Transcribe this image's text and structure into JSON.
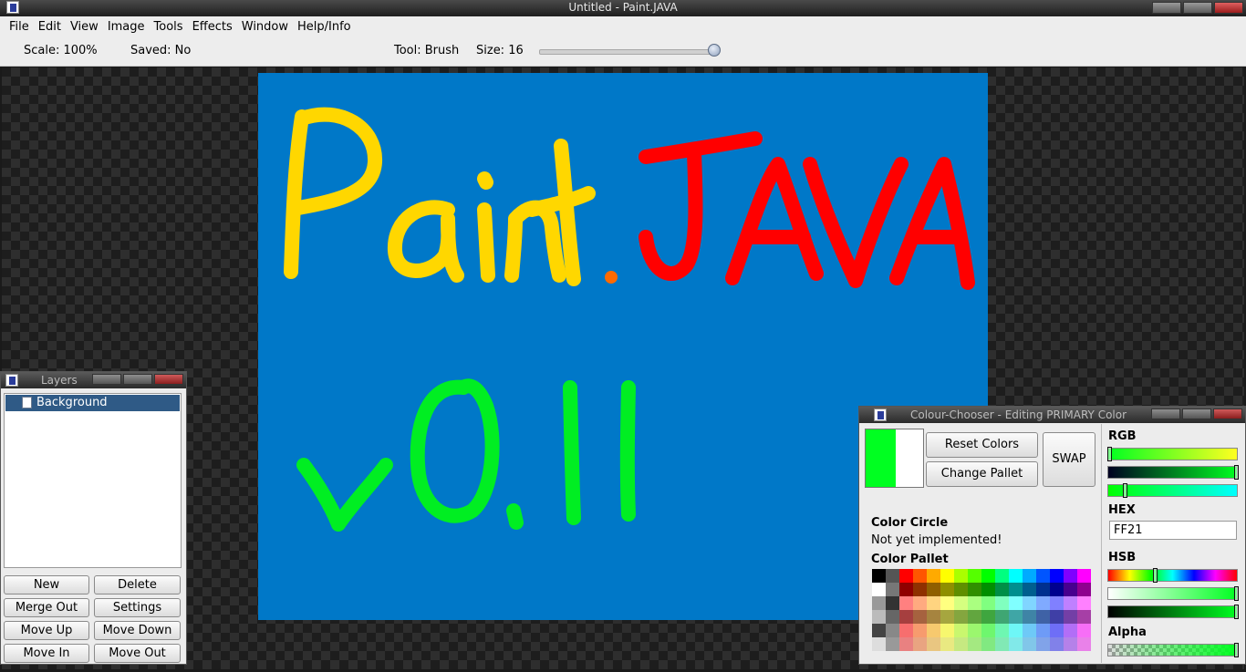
{
  "window": {
    "title": "Untitled - Paint.JAVA"
  },
  "menu": [
    "File",
    "Edit",
    "View",
    "Image",
    "Tools",
    "Effects",
    "Window",
    "Help/Info"
  ],
  "toolbar": {
    "scale": "Scale: 100%",
    "saved": "Saved: No",
    "tool": "Tool: Brush",
    "size": "Size: 16",
    "size_slider_fraction": 0.96
  },
  "canvas": {
    "background_color": "#0078c8",
    "drawn_text": [
      "Paint",
      "JAVA",
      "v0.11"
    ],
    "stroke_colors": {
      "paint": "#ffd700",
      "java": "#ff0000",
      "version": "#00ee22",
      "dot": "#ff6a00"
    }
  },
  "layers_panel": {
    "title": "Layers",
    "items": [
      "Background"
    ],
    "buttons": {
      "new": "New",
      "delete": "Delete",
      "merge_out": "Merge Out",
      "settings": "Settings",
      "move_up": "Move Up",
      "move_down": "Move Down",
      "move_in": "Move In",
      "move_out": "Move Out"
    }
  },
  "colour_chooser": {
    "title": "Colour-Chooser - Editing PRIMARY Color",
    "primary_color": "#00ff21",
    "secondary_color": "#ffffff",
    "reset_colors": "Reset Colors",
    "change_pallet": "Change Pallet",
    "swap": "SWAP",
    "color_circle_label": "Color Circle",
    "color_circle_note": "Not yet implemented!",
    "color_pallet_label": "Color Pallet",
    "rgb_label": "RGB",
    "hex_label": "HEX",
    "hex_value": "FF21",
    "hsb_label": "HSB",
    "alpha_label": "Alpha"
  }
}
